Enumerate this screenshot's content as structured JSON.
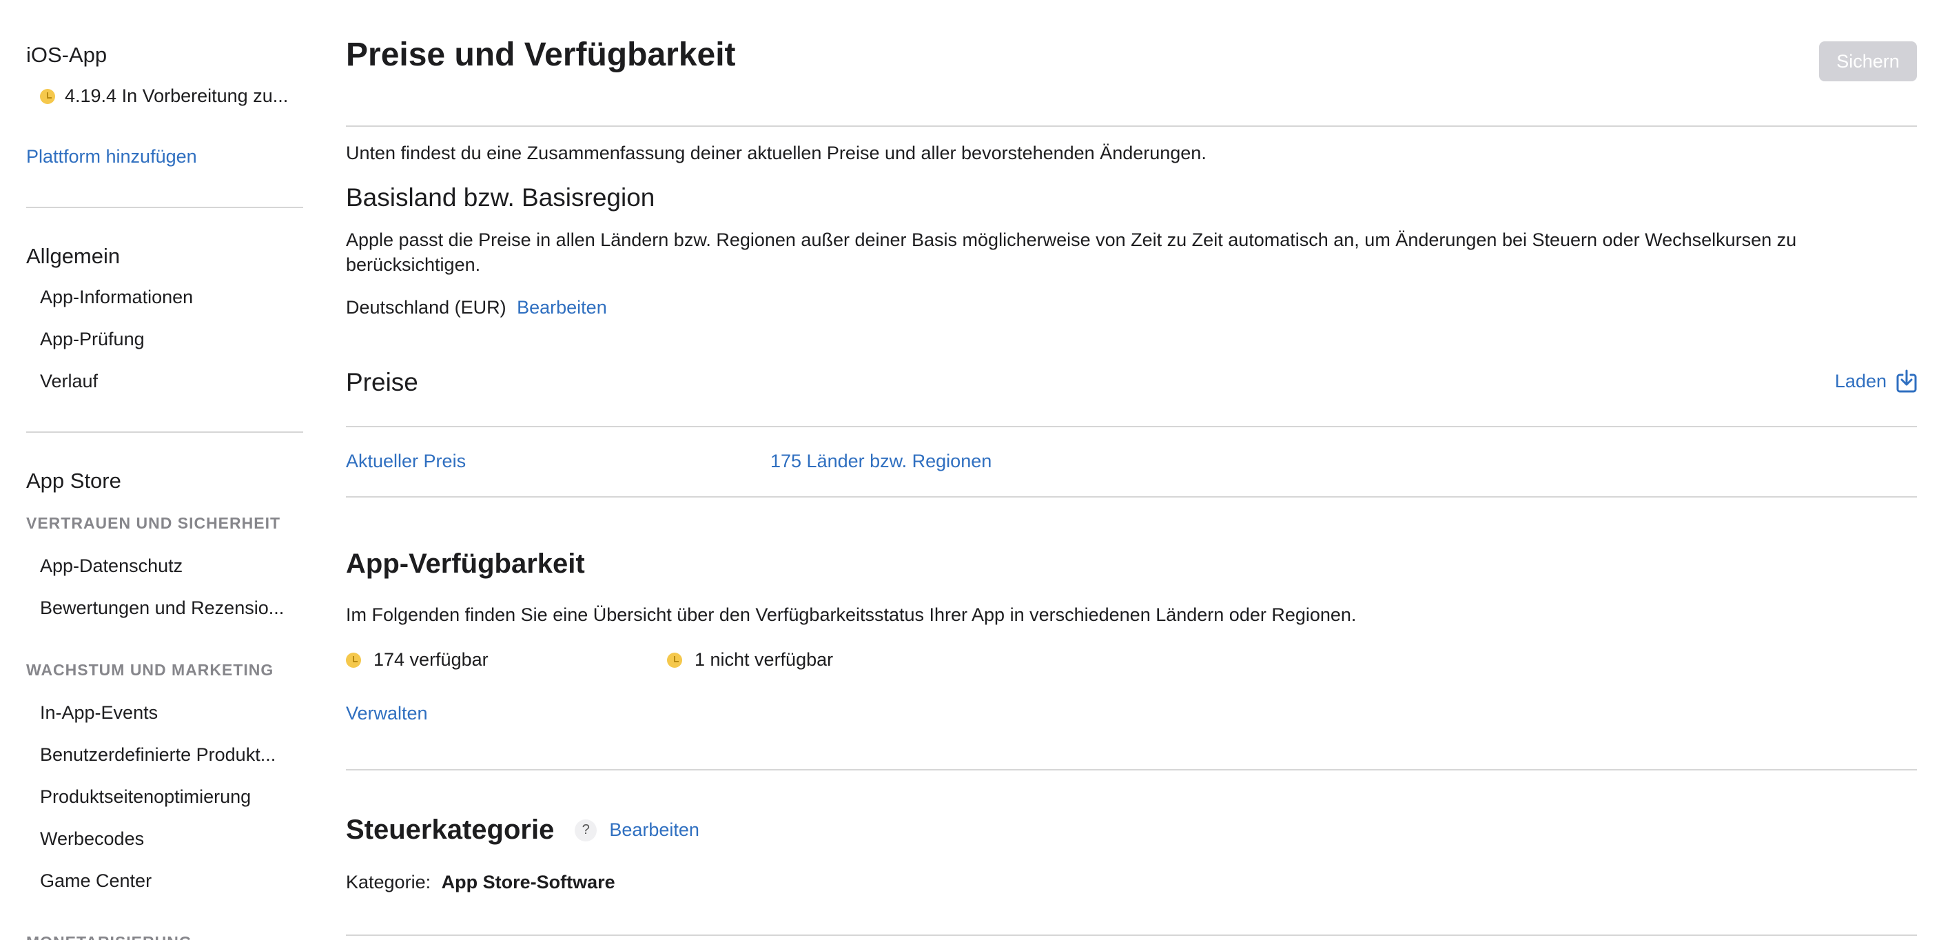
{
  "sidebar": {
    "app_title": "iOS-App",
    "version_status": "4.19.4 In Vorbereitung zu...",
    "add_platform": "Plattform hinzufügen",
    "general_heading": "Allgemein",
    "general_items": [
      "App-Informationen",
      "App-Prüfung",
      "Verlauf"
    ],
    "appstore_heading": "App Store",
    "trust_caption": "VERTRAUEN UND SICHERHEIT",
    "trust_items": [
      "App-Datenschutz",
      "Bewertungen und Rezensio..."
    ],
    "growth_caption": "WACHSTUM UND MARKETING",
    "growth_items": [
      "In-App-Events",
      "Benutzerdefinierte Produkt...",
      "Produktseitenoptimierung",
      "Werbecodes",
      "Game Center"
    ],
    "monetization_caption": "MONETARISIERUNG"
  },
  "main": {
    "title": "Preise und Verfügbarkeit",
    "save_label": "Sichern",
    "summary": "Unten findest du eine Zusammenfassung deiner aktuellen Preise und aller bevorstehenden Änderungen.",
    "base_heading": "Basisland bzw. Basisregion",
    "base_description": "Apple passt die Preise in allen Ländern bzw. Regionen außer deiner Basis möglicherweise von Zeit zu Zeit automatisch an, um Änderungen bei Steuern oder Wechselkursen zu berücksichtigen.",
    "base_country": "Deutschland (EUR)",
    "edit_label": "Bearbeiten",
    "prices_heading": "Preise",
    "load_label": "Laden",
    "current_price_label": "Aktueller Preis",
    "countries_label": "175 Länder bzw. Regionen",
    "availability_heading": "App-Verfügbarkeit",
    "availability_description": "Im Folgenden finden Sie eine Übersicht über den Verfügbarkeitsstatus Ihrer App in verschiedenen Ländern oder Regionen.",
    "available": "174 verfügbar",
    "unavailable": "1 nicht verfügbar",
    "manage_label": "Verwalten",
    "tax_heading": "Steuerkategorie",
    "help_mark": "?",
    "tax_edit_label": "Bearbeiten",
    "category_label": "Kategorie:",
    "category_value": "App Store-Software"
  },
  "colors": {
    "link": "#2f6fc0",
    "status_dot": "#f5c84c",
    "divider": "#d6d6d6",
    "disabled_button": "#d2d2d7"
  },
  "icons": {
    "status": "clock-badge-icon",
    "load": "download-tray-icon",
    "help": "question-mark-icon"
  }
}
